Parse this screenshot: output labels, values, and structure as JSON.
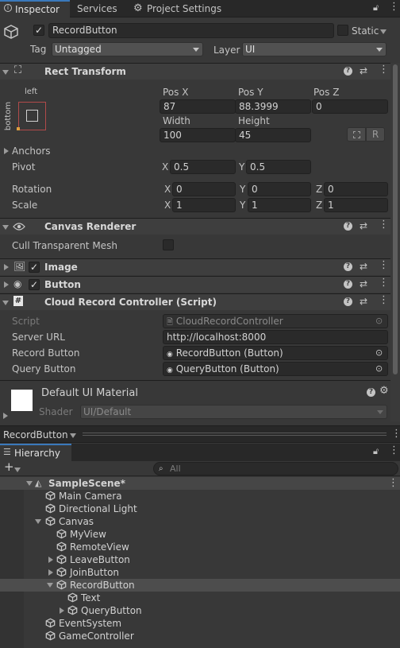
{
  "tabs": {
    "inspector": "Inspector",
    "services": "Services",
    "project_settings": "Project Settings"
  },
  "object": {
    "name": "RecordButton",
    "static_label": "Static",
    "tag_label": "Tag",
    "tag_value": "Untagged",
    "layer_label": "Layer",
    "layer_value": "UI"
  },
  "rect_transform": {
    "title": "Rect Transform",
    "anchor_h": "left",
    "anchor_v": "bottom",
    "pos_x_label": "Pos X",
    "pos_y_label": "Pos Y",
    "pos_z_label": "Pos Z",
    "pos_x": "87",
    "pos_y": "88.3999",
    "pos_z": "0",
    "width_label": "Width",
    "height_label": "Height",
    "width": "100",
    "height": "45",
    "r_button": "R",
    "anchors_label": "Anchors",
    "pivot_label": "Pivot",
    "pivot_x": "0.5",
    "pivot_y": "0.5",
    "rotation_label": "Rotation",
    "rot_x": "0",
    "rot_y": "0",
    "rot_z": "0",
    "scale_label": "Scale",
    "scale_x": "1",
    "scale_y": "1",
    "scale_z": "1",
    "x": "X",
    "y": "Y",
    "z": "Z"
  },
  "canvas_renderer": {
    "title": "Canvas Renderer",
    "cull_label": "Cull Transparent Mesh"
  },
  "image": {
    "title": "Image"
  },
  "button": {
    "title": "Button"
  },
  "cloud": {
    "title": "Cloud Record Controller (Script)",
    "script_label": "Script",
    "script_value": "CloudRecordController",
    "server_label": "Server URL",
    "server_value": "http://localhost:8000",
    "record_label": "Record Button",
    "record_value": "RecordButton (Button)",
    "query_label": "Query Button",
    "query_value": "QueryButton (Button)"
  },
  "material": {
    "title": "Default UI Material",
    "shader_label": "Shader",
    "shader_value": "UI/Default"
  },
  "preview_bar": {
    "label": "RecordButton"
  },
  "hierarchy": {
    "title": "Hierarchy",
    "search_placeholder": "All",
    "scene": "SampleScene*",
    "items": {
      "main_camera": "Main Camera",
      "directional_light": "Directional Light",
      "canvas": "Canvas",
      "my_view": "MyView",
      "remote_view": "RemoteView",
      "leave_button": "LeaveButton",
      "join_button": "JoinButton",
      "record_button": "RecordButton",
      "text": "Text",
      "query_button": "QueryButton",
      "event_system": "EventSystem",
      "game_controller": "GameController"
    }
  },
  "colors": {
    "background": "#383838",
    "header": "#3e3e3e",
    "tab_active": "#383838",
    "tab_bar": "#282828",
    "selected_row": "#4d4d4d",
    "field": "#2a2a2a"
  },
  "icons": [
    "gameobject-cube-icon",
    "lock-icon",
    "kebab-menu-icon",
    "gear-icon",
    "help-icon",
    "preset-icon",
    "rect-transform-icon",
    "eye-icon",
    "image-icon",
    "button-icon",
    "script-hash-icon",
    "object-picker-icon",
    "search-icon",
    "plus-icon",
    "unity-scene-icon"
  ]
}
